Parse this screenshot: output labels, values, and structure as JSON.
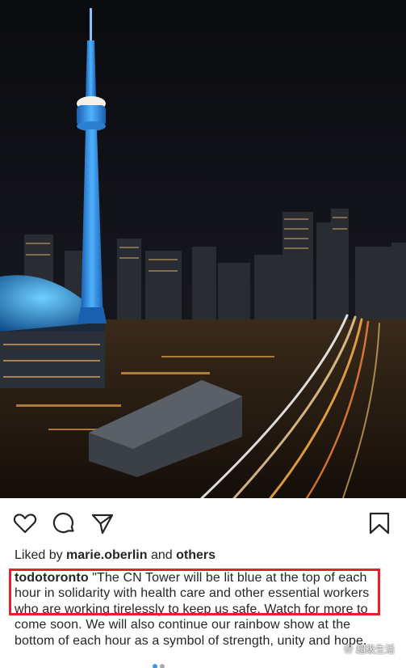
{
  "post": {
    "photo_subject": "Toronto skyline at night with the CN Tower",
    "liked_by_prefix": "Liked by",
    "liked_by_user": "marie.oberlin",
    "liked_by_and": "and",
    "liked_by_others": "others",
    "caption_user": "todotoronto",
    "caption_text": "\"The CN Tower will be lit blue at the top of each hour in solidarity with health care and other essential workers who are working tirelessly to keep us safe. Watch for more to come soon. We will also continue our rainbow show at the bottom of each hour as a symbol of strength, unity and hope."
  },
  "watermark": {
    "text": "超级生活"
  },
  "icons": {
    "like": "heart-icon",
    "comment": "comment-icon",
    "share": "paper-plane-icon",
    "save": "bookmark-icon"
  },
  "colors": {
    "highlight_box": "#e8202a",
    "tower_glow": "#2d8fe0",
    "light_trail": "#ffb347"
  }
}
